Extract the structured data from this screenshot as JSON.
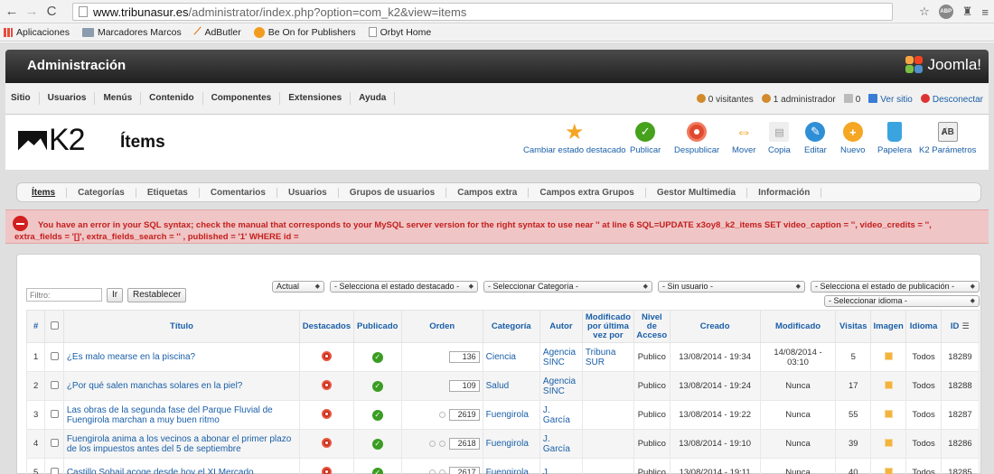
{
  "browser": {
    "url_domain": "www.tribunasur.es",
    "url_path": "/administrator/index.php?option=com_k2&view=items",
    "bookmarks": [
      "Aplicaciones",
      "Marcadores Marcos",
      "AdButler",
      "Be On for Publishers",
      "Orbyt Home"
    ]
  },
  "header": {
    "title": "Administración",
    "brand": "Joomla!"
  },
  "menu": {
    "items": [
      "Sitio",
      "Usuarios",
      "Menús",
      "Contenido",
      "Componentes",
      "Extensiones",
      "Ayuda"
    ]
  },
  "status": {
    "visitors": "0 visitantes",
    "admins": "1 administrador",
    "messages": "0",
    "view_site": "Ver sitio",
    "logout": "Desconectar"
  },
  "page": {
    "logo": "K2",
    "title": "Ítems"
  },
  "toolbar": [
    {
      "label": "Cambiar estado destacado",
      "icon": "star-icon",
      "color": "#f5a623"
    },
    {
      "label": "Publicar",
      "icon": "check-icon",
      "color": "#46a11d"
    },
    {
      "label": "Despublicar",
      "icon": "unpublish-icon",
      "color": "#e04a2f"
    },
    {
      "label": "Mover",
      "icon": "move-icon",
      "color": "#f39c12"
    },
    {
      "label": "Copia",
      "icon": "copy-icon",
      "color": "#cccccc"
    },
    {
      "label": "Editar",
      "icon": "edit-icon",
      "color": "#2f8fd6"
    },
    {
      "label": "Nuevo",
      "icon": "new-icon",
      "color": "#f5a623"
    },
    {
      "label": "Papelera",
      "icon": "trash-icon",
      "color": "#3aa4e0"
    },
    {
      "label": "K2 Parámetros",
      "icon": "params-icon",
      "color": "#999999"
    }
  ],
  "subnav": [
    "Ítems",
    "Categorías",
    "Etiquetas",
    "Comentarios",
    "Usuarios",
    "Grupos de usuarios",
    "Campos extra",
    "Campos extra Grupos",
    "Gestor Multimedia",
    "Información"
  ],
  "error": {
    "message": "You have an error in your SQL syntax; check the manual that corresponds to your MySQL server version for the right syntax to use near '' at line 6 SQL=UPDATE x3oy8_k2_items SET video_caption = '', video_credits = '', extra_fields = '[]', extra_fields_search = '' , published = '1' WHERE id ="
  },
  "filters": {
    "filter_placeholder": "Filtro:",
    "go": "Ir",
    "reset": "Restablecer",
    "trash": "Actual",
    "featured": "- Selecciona el estado destacado -",
    "category": "- Seleccionar Categoría -",
    "author": "- Sin usuario -",
    "state": "- Selecciona el estado de publicación -",
    "language": "- Seleccionar idioma -"
  },
  "table": {
    "headers": [
      "#",
      "",
      "Título",
      "Destacados",
      "Publicado",
      "Orden",
      "Categoría",
      "Autor",
      "Modificado por última vez por",
      "Nivel de Acceso",
      "Creado",
      "Modificado",
      "Visitas",
      "Imagen",
      "Idioma",
      "ID"
    ],
    "rows": [
      {
        "num": "1",
        "title": "¿Es malo mearse en la piscina?",
        "order": "136",
        "category": "Ciencia",
        "author": "Agencia SINC",
        "modified_by": "Tribuna SUR",
        "access": "Publico",
        "created": "13/08/2014 - 19:34",
        "modified": "14/08/2014 - 03:10",
        "hits": "5",
        "lang": "Todos",
        "id": "18289",
        "up": false,
        "down": false
      },
      {
        "num": "2",
        "title": "¿Por qué salen manchas solares en la piel?",
        "order": "109",
        "category": "Salud",
        "author": "Agencia SINC",
        "modified_by": "",
        "access": "Publico",
        "created": "13/08/2014 - 19:24",
        "modified": "Nunca",
        "hits": "17",
        "lang": "Todos",
        "id": "18288",
        "up": false,
        "down": false
      },
      {
        "num": "3",
        "title": "Las obras de la segunda fase del Parque Fluvial de Fuengirola marchan a muy buen ritmo",
        "order": "2619",
        "category": "Fuengirola",
        "author": "J. García",
        "modified_by": "",
        "access": "Publico",
        "created": "13/08/2014 - 19:22",
        "modified": "Nunca",
        "hits": "55",
        "lang": "Todos",
        "id": "18287",
        "up": false,
        "down": true
      },
      {
        "num": "4",
        "title": "Fuengirola anima a los vecinos a abonar el primer plazo de los impuestos antes del 5 de septiembre",
        "order": "2618",
        "category": "Fuengirola",
        "author": "J. García",
        "modified_by": "",
        "access": "Publico",
        "created": "13/08/2014 - 19:10",
        "modified": "Nunca",
        "hits": "39",
        "lang": "Todos",
        "id": "18286",
        "up": true,
        "down": true
      },
      {
        "num": "5",
        "title": "Castillo Sohail acoge desde hoy el XI Mercado",
        "order": "2617",
        "category": "Fuengirola",
        "author": "J.",
        "modified_by": "",
        "access": "Publico",
        "created": "13/08/2014 - 19:11",
        "modified": "Nunca",
        "hits": "40",
        "lang": "Todos",
        "id": "18285",
        "up": true,
        "down": true
      }
    ]
  }
}
